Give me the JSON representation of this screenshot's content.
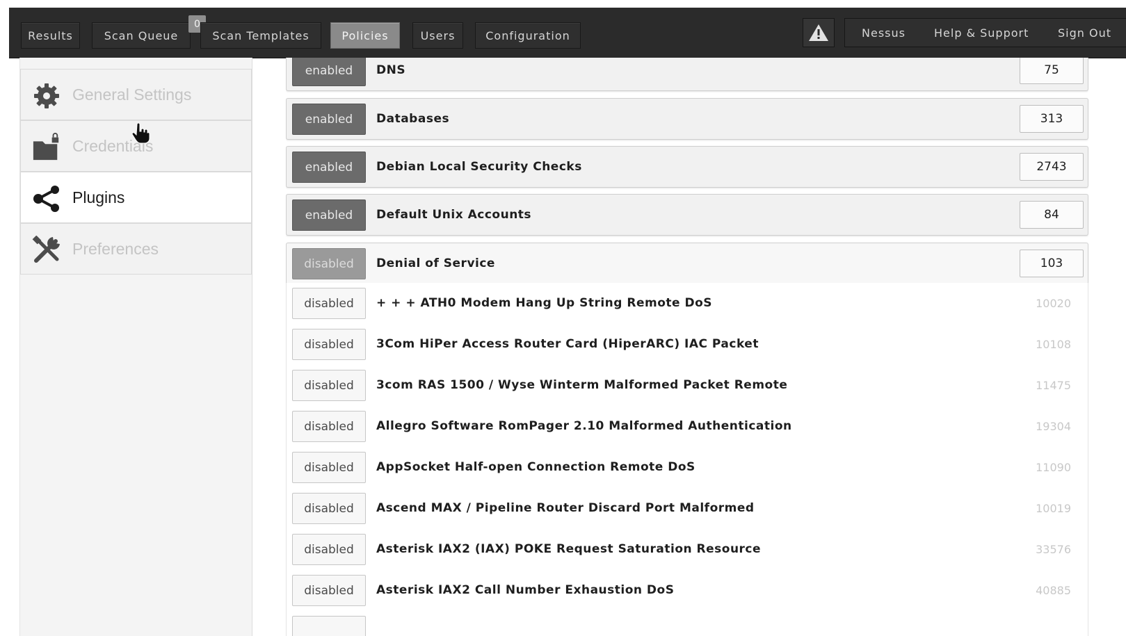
{
  "nav": {
    "tabs": [
      {
        "label": "Results"
      },
      {
        "label": "Scan Queue"
      },
      {
        "label": "Scan Templates"
      },
      {
        "label": "Policies"
      },
      {
        "label": "Users"
      },
      {
        "label": "Configuration"
      }
    ],
    "active_tab": "Policies",
    "queue_badge": "0",
    "right_links": [
      {
        "label": "Nessus"
      },
      {
        "label": "Help & Support"
      },
      {
        "label": "Sign Out"
      }
    ],
    "alert_icon": "warning-triangle-icon"
  },
  "sidebar": {
    "items": [
      {
        "label": "General Settings",
        "icon": "gear-icon",
        "active": false
      },
      {
        "label": "Credentials",
        "icon": "folder-lock-icon",
        "active": false
      },
      {
        "label": "Plugins",
        "icon": "share-nodes-icon",
        "active": true
      },
      {
        "label": "Preferences",
        "icon": "tools-icon",
        "active": false
      }
    ]
  },
  "families": [
    {
      "status": "enabled",
      "name": "DNS",
      "count": "75"
    },
    {
      "status": "enabled",
      "name": "Databases",
      "count": "313"
    },
    {
      "status": "enabled",
      "name": "Debian Local Security Checks",
      "count": "2743"
    },
    {
      "status": "enabled",
      "name": "Default Unix Accounts",
      "count": "84"
    },
    {
      "status": "disabled",
      "name": "Denial of Service",
      "count": "103"
    }
  ],
  "plugins": [
    {
      "status": "disabled",
      "name": "+ + + ATH0 Modem Hang Up String Remote DoS",
      "id": "10020"
    },
    {
      "status": "disabled",
      "name": "3Com HiPer Access Router Card (HiperARC) IAC Packet",
      "id": "10108"
    },
    {
      "status": "disabled",
      "name": "3com RAS 1500 / Wyse Winterm Malformed Packet Remote",
      "id": "11475"
    },
    {
      "status": "disabled",
      "name": "Allegro Software RomPager 2.10 Malformed Authentication",
      "id": "19304"
    },
    {
      "status": "disabled",
      "name": "AppSocket Half-open Connection Remote DoS",
      "id": "11090"
    },
    {
      "status": "disabled",
      "name": "Ascend MAX / Pipeline Router Discard Port Malformed",
      "id": "10019"
    },
    {
      "status": "disabled",
      "name": "Asterisk IAX2 (IAX) POKE Request Saturation Resource",
      "id": "33576"
    },
    {
      "status": "disabled",
      "name": "Asterisk IAX2 Call Number Exhaustion DoS",
      "id": "40885"
    }
  ],
  "colors": {
    "topbar": "#2b2b2b",
    "active_tab": "#8a8a8a",
    "enabled_button": "#6b6b6b",
    "disabled_family_button": "#9a9a9a"
  }
}
